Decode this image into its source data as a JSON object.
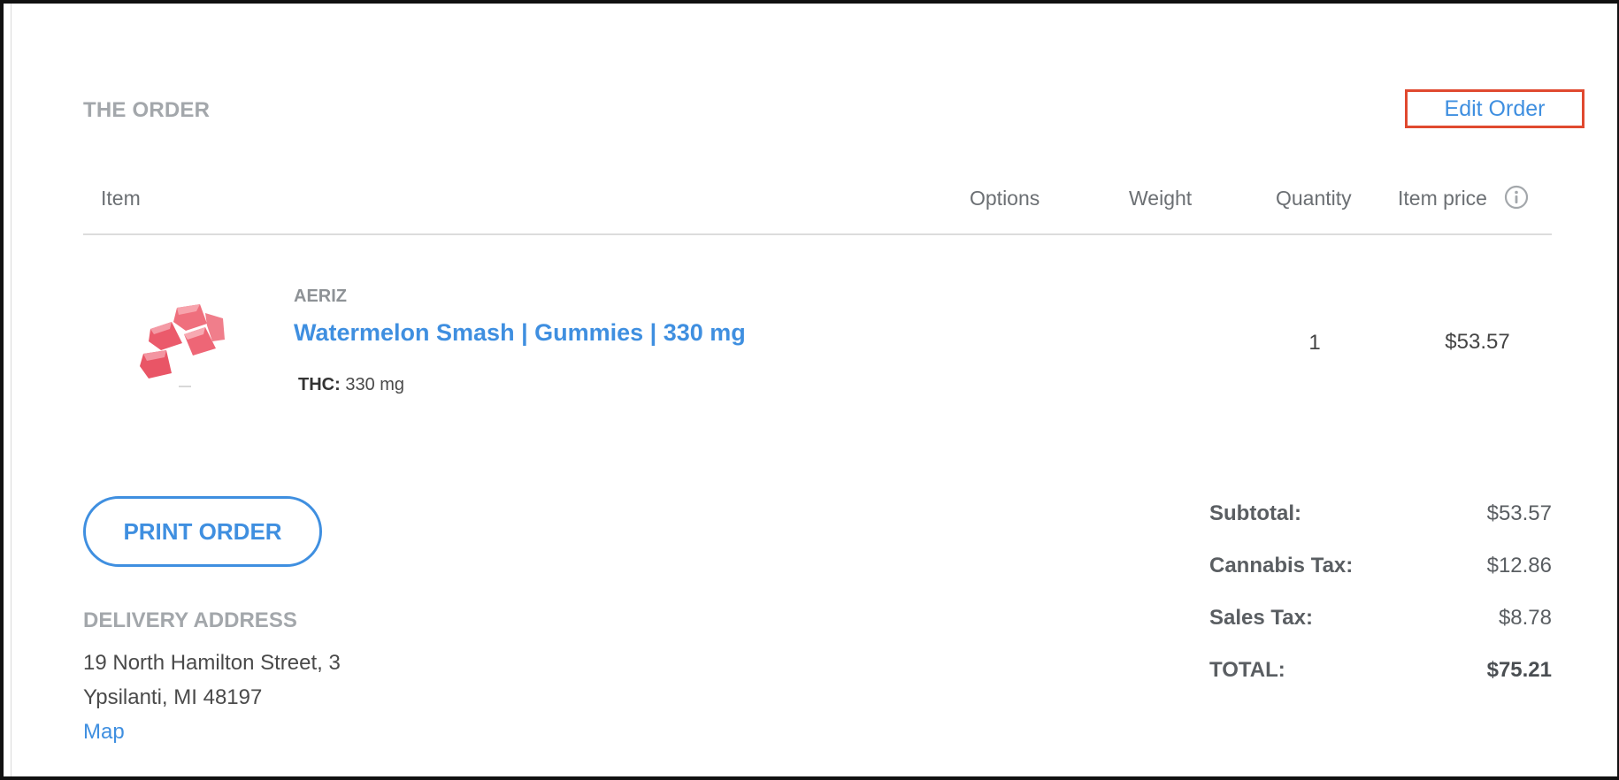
{
  "order": {
    "section_title": "THE ORDER",
    "edit_label": "Edit Order",
    "columns": {
      "item": "Item",
      "options": "Options",
      "weight": "Weight",
      "quantity": "Quantity",
      "item_price": "Item price"
    },
    "items": [
      {
        "brand": "AERIZ",
        "name": "Watermelon Smash | Gummies | 330 mg",
        "thc_label": "THC:",
        "thc_value": "330 mg",
        "quantity": "1",
        "price": "$53.57",
        "image_icon": "watermelon-gummies-image"
      }
    ]
  },
  "actions": {
    "print_label": "PRINT ORDER"
  },
  "delivery": {
    "title": "DELIVERY ADDRESS",
    "line1": "19 North Hamilton Street, 3",
    "line2": "Ypsilanti, MI 48197",
    "map_label": "Map"
  },
  "summary": {
    "subtotal_label": "Subtotal:",
    "subtotal_value": "$53.57",
    "cannabis_tax_label": "Cannabis Tax:",
    "cannabis_tax_value": "$12.86",
    "sales_tax_label": "Sales Tax:",
    "sales_tax_value": "$8.78",
    "total_label": "TOTAL:",
    "total_value": "$75.21"
  },
  "colors": {
    "accent": "#3f8fe0",
    "highlight_border": "#e0492f",
    "muted_heading": "#a3a7ab"
  }
}
